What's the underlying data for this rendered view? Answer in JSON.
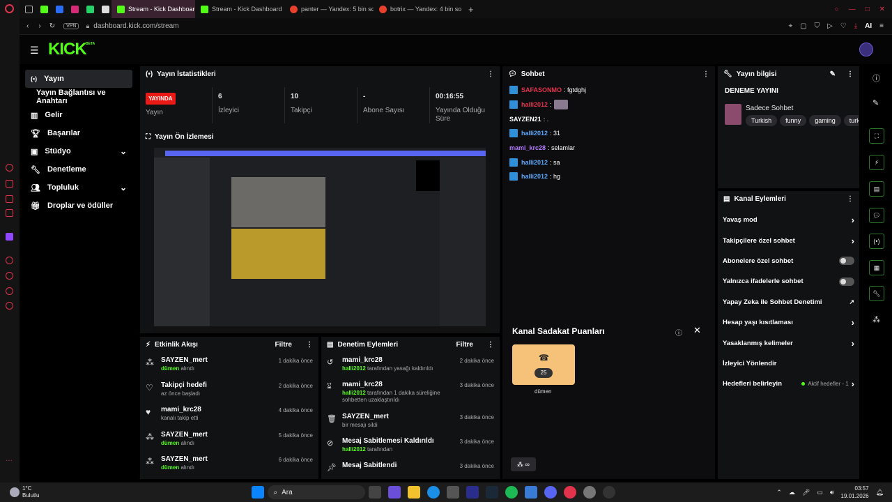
{
  "browser": {
    "tabs": [
      {
        "label": "Stream - Kick Dashboard",
        "color": "#53fc18"
      },
      {
        "label": "Stream - Kick Dashboard",
        "color": "#53fc18"
      },
      {
        "label": "panter — Yandex: 5 bin so",
        "color": "#e8412b"
      },
      {
        "label": "botrix — Yandex: 4 bin so",
        "color": "#e8412b"
      }
    ],
    "url": "dashboard.kick.com/stream",
    "vpn_label": "VPN",
    "ai_label": "AI"
  },
  "brand": {
    "logo": "KICK",
    "beta": "BETA",
    "color": "#53fc18"
  },
  "sidebar": {
    "items": [
      {
        "label": "Yayın",
        "icon": "broadcast-icon",
        "expand": false
      },
      {
        "label": "Yayın Bağlantısı ve Anahtarı",
        "icon": "",
        "expand": false
      },
      {
        "label": "Gelir",
        "icon": "chart-icon",
        "expand": false
      },
      {
        "label": "Başarılar",
        "icon": "trophy-icon",
        "expand": false
      },
      {
        "label": "Stüdyo",
        "icon": "studio-icon",
        "expand": true
      },
      {
        "label": "Denetleme",
        "icon": "wrench-icon",
        "expand": false
      },
      {
        "label": "Topluluk",
        "icon": "people-icon",
        "expand": true
      },
      {
        "label": "Droplar ve ödüller",
        "icon": "gift-icon",
        "expand": false
      }
    ]
  },
  "stats": {
    "title": "Yayın İstatistikleri",
    "live_badge": "YAYINDA",
    "live_label": "Yayın",
    "viewers": "6",
    "viewers_label": "İzleyici",
    "followers": "10",
    "followers_label": "Takipçi",
    "subs": "-",
    "subs_label": "Abone Sayısı",
    "uptime": "00:16:55",
    "uptime_label": "Yayında Olduğu Süre"
  },
  "preview": {
    "title": "Yayın Ön İzlemesi"
  },
  "activity": {
    "title": "Etkinlik Akışı",
    "filter": "Filtre",
    "items": [
      {
        "name": "SAYZEN_mert",
        "pre": "",
        "hl": "dümen",
        "post": " alındı",
        "time": "1 dakika önce"
      },
      {
        "name": "Takipçi hedefi",
        "pre": "az önce başladı",
        "hl": "",
        "post": "",
        "time": "2 dakika önce"
      },
      {
        "name": "mami_krc28",
        "pre": "kanalı takip etti",
        "hl": "",
        "post": "",
        "time": "4 dakika önce"
      },
      {
        "name": "SAYZEN_mert",
        "pre": "",
        "hl": "dümen",
        "post": " alındı",
        "time": "5 dakika önce"
      },
      {
        "name": "SAYZEN_mert",
        "pre": "",
        "hl": "dümen",
        "post": " alındı",
        "time": "6 dakika önce"
      }
    ]
  },
  "moderation": {
    "title": "Denetim Eylemleri",
    "filter": "Filtre",
    "items": [
      {
        "name": "mami_krc28",
        "hl": "halli2012",
        "post": " tarafından yasağı kaldırıldı",
        "time": "2 dakika önce"
      },
      {
        "name": "mami_krc28",
        "hl": "halli2012",
        "post": " tarafından 1 dakika süreliğine sohbetten uzaklaştırıldı",
        "time": "3 dakika önce"
      },
      {
        "name": "SAYZEN_mert",
        "hl": "",
        "post": "bir mesajı sildi",
        "time": "3 dakika önce"
      },
      {
        "name": "Mesaj Sabitlemesi Kaldırıldı",
        "hl": "halli2012",
        "post": " tarafından",
        "time": "3 dakika önce"
      },
      {
        "name": "Mesaj Sabitlendi",
        "hl": "",
        "post": "",
        "time": "3 dakika önce"
      }
    ]
  },
  "chat": {
    "title": "Sohbet",
    "messages": [
      {
        "user": "SAFASONMO",
        "color": "#e2334d",
        "text": ": fgtdghj",
        "badge": true
      },
      {
        "user": "halli2012",
        "color": "#e2334d",
        "text": ":",
        "badge": true
      },
      {
        "user": "SAYZEN21",
        "color": "#ffffff",
        "text": ": .",
        "badge": false
      },
      {
        "user": "halli2012",
        "color": "#56a8ff",
        "text": ": 31",
        "badge": true
      },
      {
        "user": "mami_krc28",
        "color": "#b57cff",
        "text": ": selamlar",
        "badge": false
      },
      {
        "user": "halli2012",
        "color": "#56a8ff",
        "text": ": sa",
        "badge": true
      },
      {
        "user": "halli2012",
        "color": "#56a8ff",
        "text": ": hg",
        "badge": true
      }
    ]
  },
  "loyalty": {
    "title": "Kanal Sadakat Puanları",
    "reward_cost": "25",
    "reward_name": "dümen"
  },
  "info": {
    "title": "Yayın bilgisi",
    "stream_title": "DENEME YAYINI",
    "category": "Sadece Sohbet",
    "tags": [
      "Turkish",
      "funny",
      "gaming",
      "turkçe"
    ]
  },
  "channel_actions": {
    "title": "Kanal Eylemleri",
    "items": [
      {
        "label": "Yavaş mod",
        "kind": "chevron",
        "extra": ""
      },
      {
        "label": "Takipçilere özel sohbet",
        "kind": "chevron",
        "extra": ""
      },
      {
        "label": "Abonelere özel sohbet",
        "kind": "toggle",
        "extra": ""
      },
      {
        "label": "Yalnızca ifadelerle sohbet",
        "kind": "toggle",
        "extra": ""
      },
      {
        "label": "Yapay Zeka ile Sohbet Denetimi",
        "kind": "external",
        "extra": ""
      },
      {
        "label": "Hesap yaşı kısıtlaması",
        "kind": "chevron",
        "extra": ""
      },
      {
        "label": "Yasaklanmış kelimeler",
        "kind": "chevron",
        "extra": ""
      },
      {
        "label": "İzleyici Yönlendir",
        "kind": "none",
        "extra": ""
      },
      {
        "label": "Hedefleri belirleyin",
        "kind": "chevron",
        "extra": "Aktif hedefler - 1"
      }
    ]
  },
  "taskbar": {
    "weather_temp": "1°C",
    "weather_desc": "Bulutlu",
    "search": "Ara",
    "time": "03:57",
    "date": "19.01.2026"
  }
}
